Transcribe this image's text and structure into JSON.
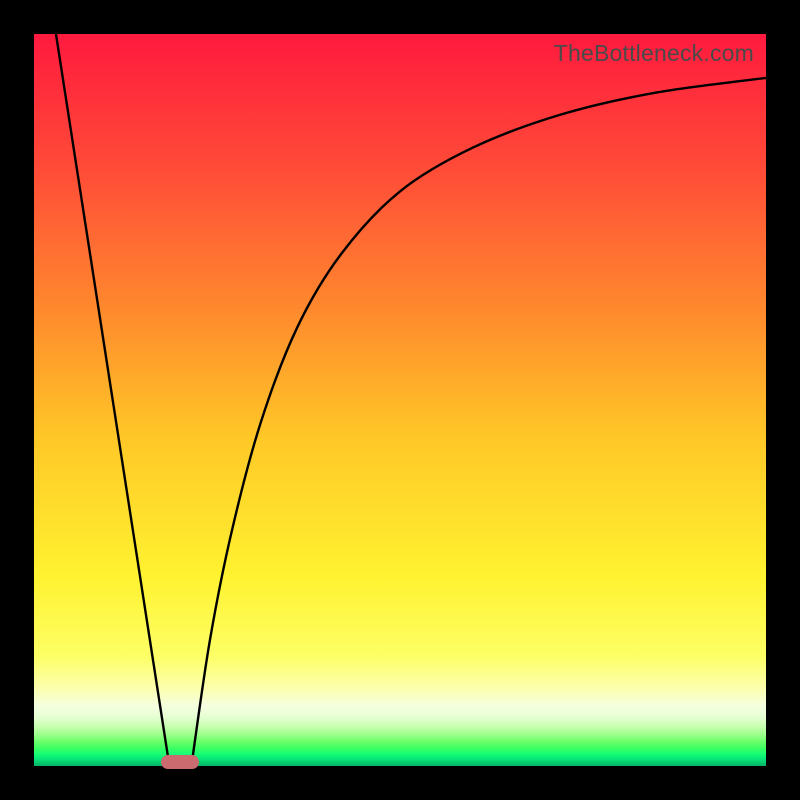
{
  "watermark": "TheBottleneck.com",
  "colors": {
    "frame": "#000000",
    "curve": "#000000",
    "marker": "#cc6b6f"
  },
  "chart_data": {
    "type": "line",
    "title": "",
    "xlabel": "",
    "ylabel": "",
    "xlim": [
      0,
      100
    ],
    "ylim": [
      0,
      100
    ],
    "grid": false,
    "legend": false,
    "annotations": [
      {
        "text_key": "watermark",
        "anchor": "top-right"
      }
    ],
    "series": [
      {
        "name": "left-linear-drop",
        "segment": "line",
        "points": [
          {
            "x": 3.0,
            "y": 100.0
          },
          {
            "x": 18.5,
            "y": 0.0
          }
        ]
      },
      {
        "name": "right-asymptotic-rise",
        "segment": "curve",
        "points": [
          {
            "x": 21.5,
            "y": 0.0
          },
          {
            "x": 24.0,
            "y": 17.0
          },
          {
            "x": 27.0,
            "y": 32.0
          },
          {
            "x": 31.0,
            "y": 47.0
          },
          {
            "x": 36.0,
            "y": 60.0
          },
          {
            "x": 42.0,
            "y": 70.0
          },
          {
            "x": 50.0,
            "y": 78.5
          },
          {
            "x": 60.0,
            "y": 84.5
          },
          {
            "x": 72.0,
            "y": 89.0
          },
          {
            "x": 85.0,
            "y": 92.0
          },
          {
            "x": 100.0,
            "y": 94.0
          }
        ]
      }
    ],
    "marker": {
      "shape": "rounded-rect",
      "x": 20.0,
      "y": 0.6,
      "width_pct": 5.2,
      "height_pct": 1.9
    },
    "background": {
      "type": "vertical-gradient",
      "stops": [
        {
          "pct": 0,
          "color": "#ff1a3e"
        },
        {
          "pct": 55,
          "color": "#ffc727"
        },
        {
          "pct": 85,
          "color": "#fdff65"
        },
        {
          "pct": 100,
          "color": "#05b566"
        }
      ]
    }
  }
}
